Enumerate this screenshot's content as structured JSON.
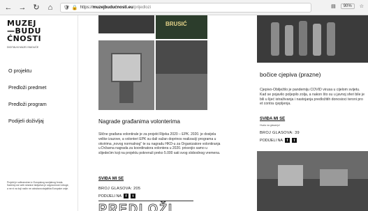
{
  "browser": {
    "url_domain": "muzejbudućnosti.eu",
    "url_path": "/prijedlozi",
    "zoom": "90%"
  },
  "sidebar": {
    "logo_lines": [
      "MUZEJ",
      "—BUDU",
      "ĆNOSTI"
    ],
    "logo_sub": "DIGITALNI MUZEJ BUDUĆE",
    "menu": [
      {
        "label": "O projektu"
      },
      {
        "label": "Predloži predmet"
      },
      {
        "label": "Predloži program"
      },
      {
        "label": "Podijeli doživljaj"
      }
    ],
    "footer_text": "Projekt je sufinanciran iz Europskog socijalnog fonda. Sadržaj ove web stranice isključiva je odgovornost Udruge, a ne ni na koji način ne odražava stajališta Europske unije."
  },
  "col1": {
    "image_caption": "BRUSIĆ",
    "title": "Nagrade građanima volonterima",
    "body": "Slične građana volontirale je za projekt Rijeka 2020 – EPK. 2020. je dosijela velike izazove, a volonteri EPK su dali važan doprinos realizaciji programa u okvirima „novog normalnog\" te su nagradu HKD-u za Organizatore volontiranja u Državna nagrada za koordinatora volontera u 2020. prisvojio samo u slijedećim koji na projektu pokrenuli preko 5.000 sati svog slobodnog vremena.",
    "svida_label": "SVIĐA MI SE",
    "votes": "BROJ GLASOVA: 205",
    "share_label": "PODIJELI NA",
    "next_heading": "PREDLOŽI"
  },
  "col2": {
    "title": "bočice cjepiva (prazne)",
    "body": "Cjepivo-Obilježilo je pandemiju COVID virusa u cijelom svijetu. Kad se pojavilo poljepilo zolja, a nakon što su u javnoj sferi bile je bili u lijeć istraživanja i nastojanja predložitih donosioci teroni pro et contra cjepljenja.",
    "svida_label": "SVIĐA MI SE",
    "svida_sub": "Hvala na glasanju!",
    "votes": "BROJ GLASOVA: 39",
    "share_label": "PODIJELI NA"
  }
}
